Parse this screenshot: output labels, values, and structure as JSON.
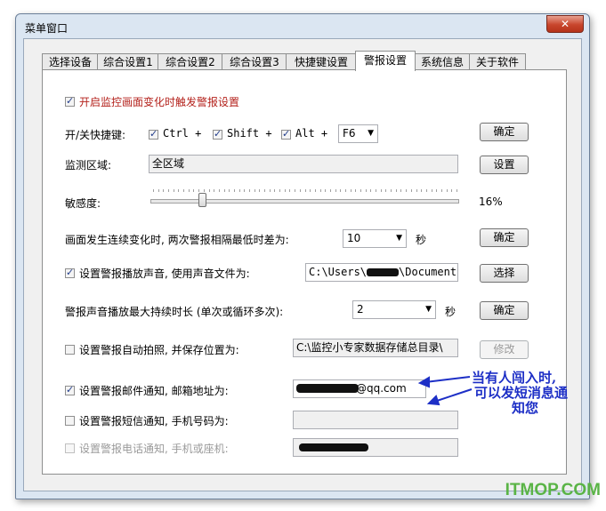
{
  "window": {
    "title": "菜单窗口",
    "close_label": "✕"
  },
  "tabs": [
    "选择设备",
    "综合设置1",
    "综合设置2",
    "综合设置3",
    "快捷键设置",
    "警报设置",
    "系统信息",
    "关于软件"
  ],
  "active_tab": "警报设置",
  "settings": {
    "enable_label": "开启监控画面变化时触发警报设置",
    "hotkey_label": "开/关快捷键:",
    "ctrl_label": "Ctrl +",
    "shift_label": "Shift +",
    "alt_label": "Alt +",
    "hotkey_key": "F6",
    "confirm_label": "确定",
    "region_label": "监测区域:",
    "region_value": "全区域",
    "region_button": "设置",
    "sensitivity_label": "敏感度:",
    "sensitivity_value": "16%",
    "sensitivity_level": 0.16,
    "interval_label": "画面发生连续变化时, 两次警报相隔最低时差为:",
    "interval_value": "10",
    "interval_unit": "秒",
    "sound_label": "设置警报播放声音, 使用声音文件为:",
    "sound_path_a": "C:\\Users\\",
    "sound_path_b": "\\Documents",
    "sound_button": "选择",
    "duration_label": "警报声音播放最大持续时长 (单次或循环多次):",
    "duration_value": "2",
    "duration_unit": "秒",
    "photo_label": "设置警报自动拍照, 并保存位置为:",
    "photo_path": "C:\\监控小专家数据存储总目录\\",
    "photo_button": "修改",
    "email_label": "设置警报邮件通知, 邮箱地址为:",
    "email_value": "@qq.com",
    "sms_label": "设置警报短信通知, 手机号码为:",
    "phone_label": "设置警报电话通知, 手机或座机:"
  },
  "annotation": [
    "当有人闯入时,",
    "可以发短消息通",
    "知您"
  ],
  "watermark": "ITMOP.COM",
  "colors": {
    "accent_red": "#b4221c",
    "annotation_blue": "#1d2fc6",
    "watermark_green": "#5ab446"
  }
}
